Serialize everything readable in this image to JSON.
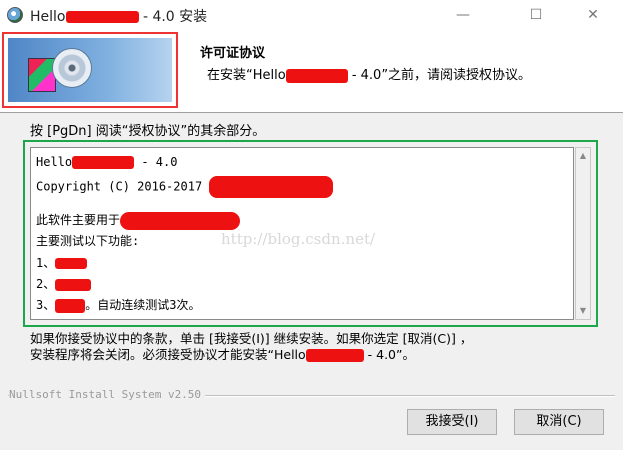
{
  "window": {
    "title_prefix": "Hello",
    "title_suffix": " - 4.0 安装",
    "minimize": "—",
    "maximize": "☐",
    "close": "✕"
  },
  "header": {
    "title": "许可证协议",
    "subtitle_prefix": "在安装“Hello",
    "subtitle_suffix": " - 4.0”之前，请阅读授权协议。"
  },
  "instruction": "按 [PgDn] 阅读“授权协议”的其余部分。",
  "license": {
    "line1_prefix": "Hello",
    "line1_suffix": " - 4.0",
    "line2": "Copyright (C) 2016-2017 ",
    "line3_prefix": "此软件主要用于",
    "line4": "主要测试以下功能:",
    "item1": "1、",
    "item2": "2、",
    "item3_prefix": "3、",
    "item3_suffix": "。自动连续测试3次。"
  },
  "watermark": "http://blog.csdn.net/",
  "notice": {
    "line1": "如果你接受协议中的条款，单击 [我接受(I)] 继续安装。如果你选定 [取消(C)] ，",
    "line2_prefix": "安装程序将会关闭。必须接受协议才能安装“Hello",
    "line2_suffix": " - 4.0”。"
  },
  "footer": {
    "branding": "Nullsoft Install System v2.50"
  },
  "buttons": {
    "accept": "我接受(I)",
    "cancel": "取消(C)"
  },
  "colors": {
    "redaction": "#ee1111",
    "logo_highlight": "#e33333",
    "license_highlight": "#1ea64a"
  }
}
